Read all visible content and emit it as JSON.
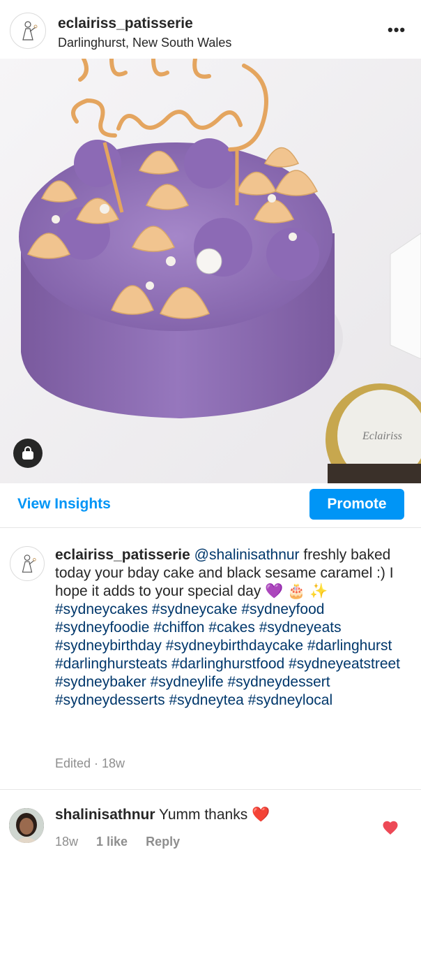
{
  "post": {
    "username": "eclairiss_patisserie",
    "location": "Darlinghurst, New South Wales",
    "more_label": "•••"
  },
  "actions": {
    "view_insights": "View Insights",
    "promote": "Promote"
  },
  "caption": {
    "username": "eclairiss_patisserie",
    "mention": "@shalinisathnur",
    "text": "freshly baked today your bday cake and black sesame caramel :) I hope it adds to your special day 💜 🎂 ✨",
    "hashtags": [
      "#sydneycakes",
      "#sydneycake",
      "#sydneyfood",
      "#sydneyfoodie",
      "#chiffon",
      "#cakes",
      "#sydneyeats",
      "#sydneybirthday",
      "#sydneybirthdaycake",
      "#darlinghurst",
      "#darlinghursteats",
      "#darlinghurstfood",
      "#sydneyeatstreet",
      "#sydneybaker",
      "#sydneylife",
      "#sydneydessert",
      "#sydneydesserts",
      "#sydneytea",
      "#sydneylocal"
    ],
    "edited": "Edited · 18w"
  },
  "comment": {
    "username": "shalinisathnur",
    "text": "Yumm thanks ❤️",
    "time": "18w",
    "likes": "1 like",
    "reply": "Reply"
  },
  "colors": {
    "accent": "#0095f6",
    "hashtag": "#00376b",
    "heart": "#ed4956",
    "cake": "#8a6bb0"
  }
}
